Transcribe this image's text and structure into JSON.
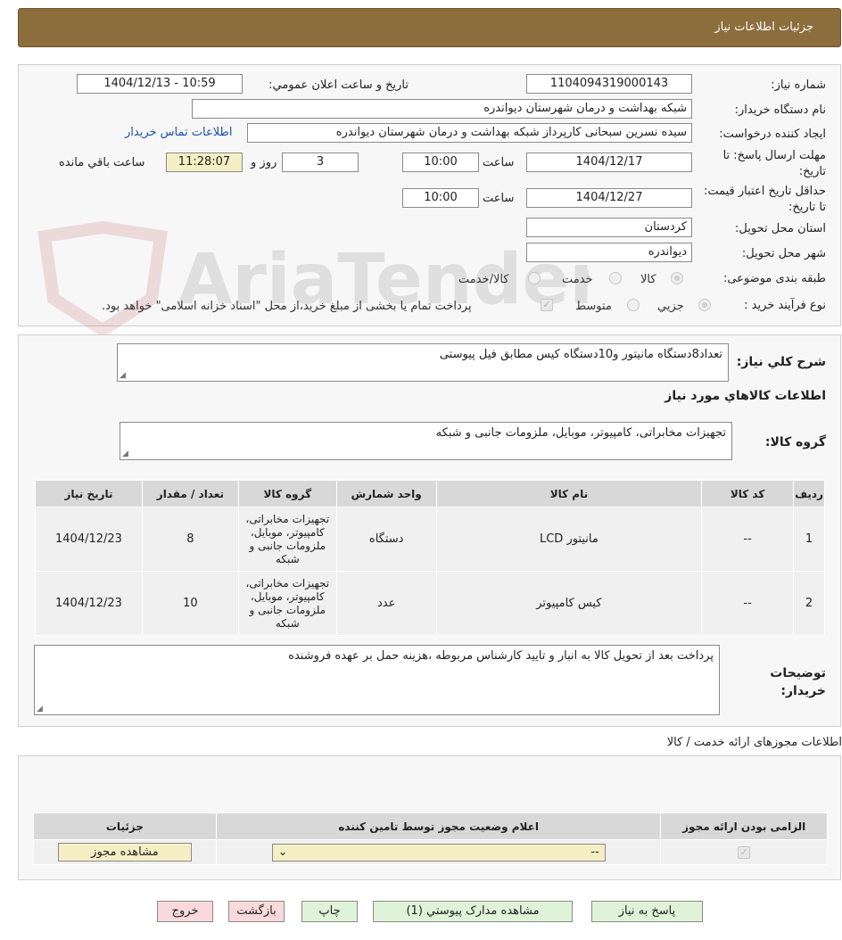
{
  "header": {
    "title": "جزئیات اطلاعات نیاز"
  },
  "watermark": {
    "text": "AriaTender.neT"
  },
  "form": {
    "need_number_label": "شماره نیاز:",
    "need_number": "1104094319000143",
    "announce_label": "تاریخ و ساعت اعلان عمومي:",
    "announce_value": "1404/12/13 - 10:59",
    "buyer_org_label": "نام دستگاه خريدار:",
    "buyer_org": "شبکه بهداشت و درمان شهرستان دیواندره",
    "requester_label": "ايجاد کننده درخواست:",
    "requester": "سیده نسرین سبحانی کارپرداز شبکه بهداشت و درمان شهرستان دیواندره",
    "contact_link": "اطلاعات تماس خريدار",
    "deadline_label": "مهلت ارسال پاسخ: تا تاريخ:",
    "deadline_date": "1404/12/17",
    "time_label": "ساعت",
    "deadline_time": "10:00",
    "days": "3",
    "days_label": "روز و",
    "remaining_time": "11:28:07",
    "remaining_label": "ساعت باقي مانده",
    "validity_label": "حداقل تاريخ اعتبار قيمت: تا تاريخ:",
    "validity_date": "1404/12/27",
    "validity_time_label": "ساعت",
    "validity_time": "10:00",
    "province_label": "استان محل تحويل:",
    "province": "کردستان",
    "city_label": "شهر محل تحويل:",
    "city": "دیواندره",
    "category_label": "طبقه بندی موضوعی:",
    "category_options": [
      "کالا",
      "خدمت",
      "کالا/خدمت"
    ],
    "process_label": "نوع فرآيند خريد :",
    "process_options": [
      "جزيي",
      "متوسط"
    ],
    "payment_note": "پرداخت تمام يا بخشی از مبلغ خريد،از محل \"اسناد خزانه اسلامی\" خواهد بود."
  },
  "description": {
    "label": "شرح کلي نياز:",
    "value": "تعداد8دستگاه مانیتور و10دستگاه کیس مطابق فیل پیوستی"
  },
  "goods": {
    "section_title": "اطلاعات کالاهاي مورد نياز",
    "group_label": "گروه کالا:",
    "group_value": "تجهیزات مخابراتی، کامپیوتر، موبایل، ملزومات جانبی و شبکه",
    "columns": [
      "رديف",
      "کد کالا",
      "نام کالا",
      "واحد شمارش",
      "گروه کالا",
      "تعداد / مقدار",
      "تاريخ نياز"
    ],
    "rows": [
      {
        "row": "1",
        "code": "--",
        "name": "مانیتور LCD",
        "unit": "دستگاه",
        "group": "تجهیزات مخابراتی، کامپیوتر، موبایل، ملزومات جانبی و شبکه",
        "qty": "8",
        "date": "1404/12/23"
      },
      {
        "row": "2",
        "code": "--",
        "name": "کیس کامپیوتر",
        "unit": "عدد",
        "group": "تجهیزات مخابراتی، کامپیوتر، موبایل، ملزومات جانبی و شبکه",
        "qty": "10",
        "date": "1404/12/23"
      }
    ]
  },
  "buyer_notes": {
    "label": "توضيحات خريدار:",
    "value": "پرداخت بعد از تحویل کالا به انبار و تایید کارشناس مربوطه ،هزینه حمل بر عهده فروشنده"
  },
  "permits": {
    "section_title": "اطلاعات مجوزهای ارائه خدمت / کالا",
    "columns": [
      "الزامی بودن ارائه مجوز",
      "اعلام وضعيت مجوز توسط تامين کننده",
      "جزئيات"
    ],
    "select_value": "--",
    "view_button": "مشاهده مجوز"
  },
  "actions": {
    "reply": "پاسخ به نياز",
    "attachments": "مشاهده مدارک پيوستي (1)",
    "print": "چاپ",
    "back": "بازگشت",
    "exit": "خروج"
  }
}
